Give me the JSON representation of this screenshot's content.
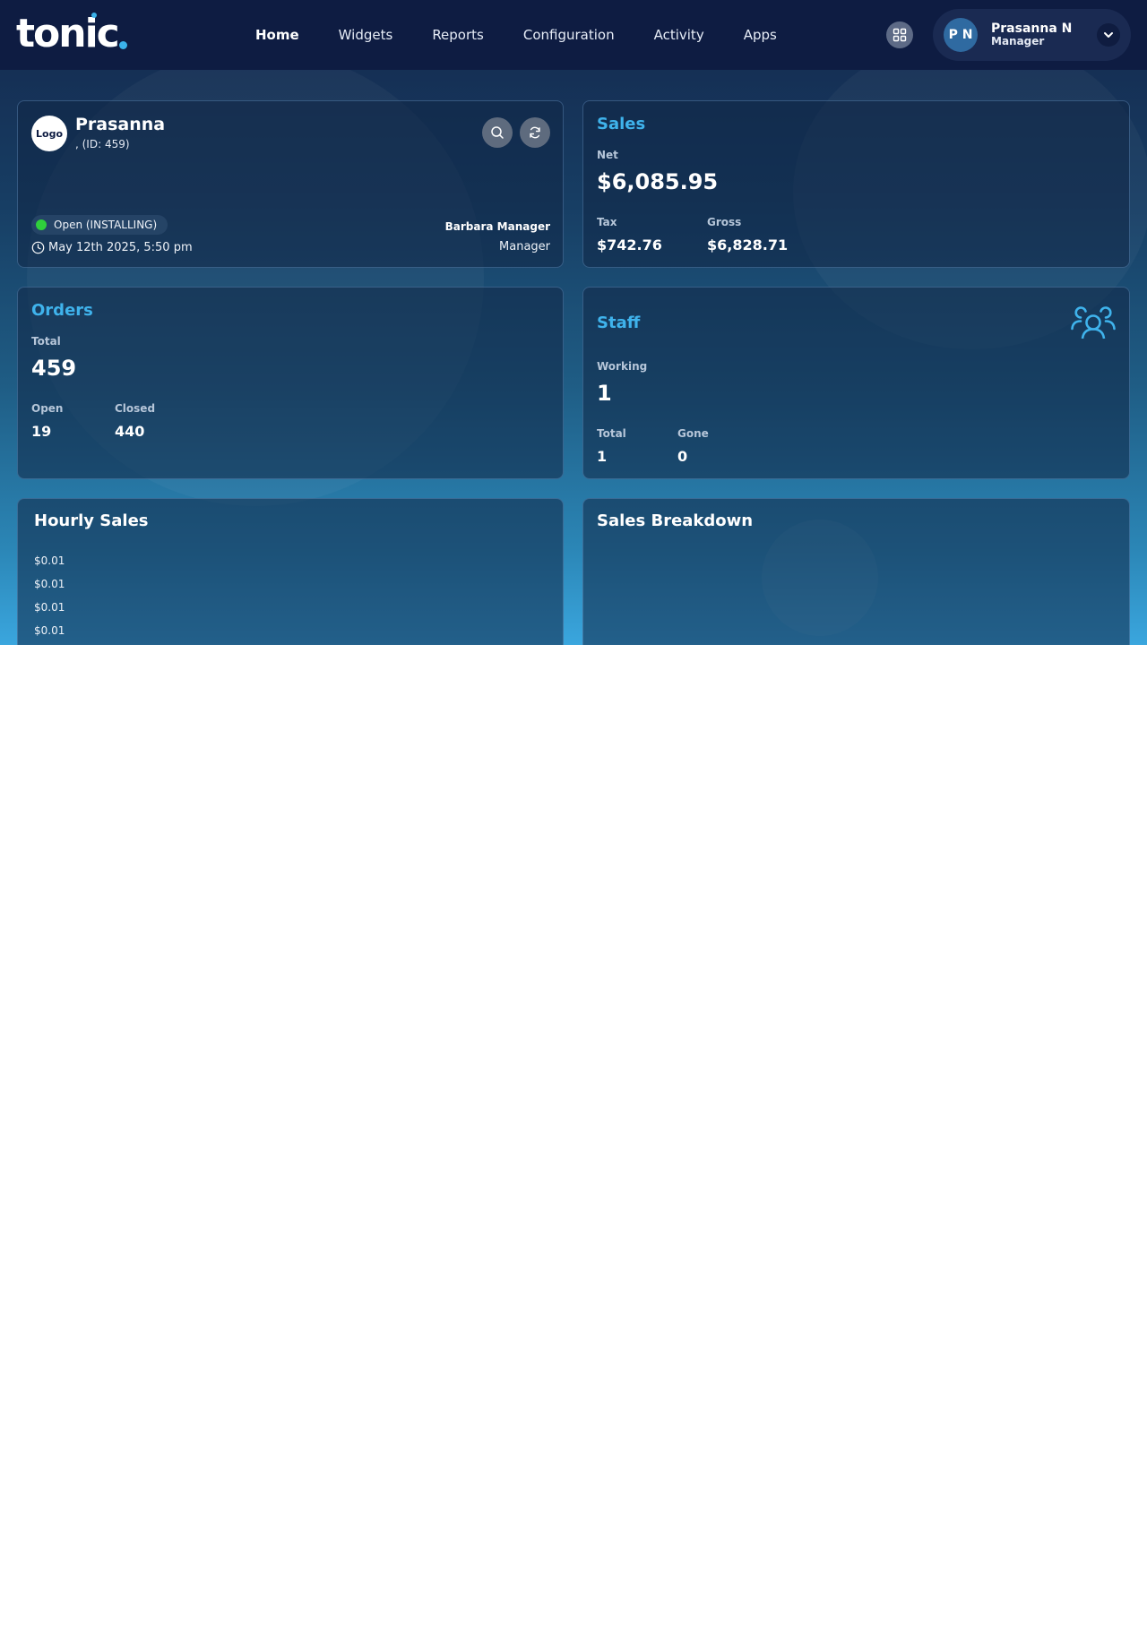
{
  "brand": {
    "logo_text": "tonic"
  },
  "nav": {
    "items": [
      {
        "label": "Home",
        "active": true
      },
      {
        "label": "Widgets"
      },
      {
        "label": "Reports"
      },
      {
        "label": "Configuration"
      },
      {
        "label": "Activity"
      },
      {
        "label": "Apps"
      }
    ]
  },
  "user": {
    "initials": "P N",
    "name": "Prasanna N",
    "role": "Manager"
  },
  "store": {
    "logo_label": "Logo",
    "name": "Prasanna",
    "id_line": ", (ID: 459)",
    "status": "Open (INSTALLING)",
    "status_color": "#2fcf3c",
    "datetime": "May 12th 2025, 5:50 pm",
    "manager_name": "Barbara Manager",
    "manager_role": "Manager"
  },
  "sales": {
    "title": "Sales",
    "net_label": "Net",
    "net_value": "$6,085.95",
    "tax_label": "Tax",
    "tax_value": "$742.76",
    "gross_label": "Gross",
    "gross_value": "$6,828.71"
  },
  "orders": {
    "title": "Orders",
    "total_label": "Total",
    "total_value": "459",
    "open_label": "Open",
    "open_value": "19",
    "closed_label": "Closed",
    "closed_value": "440"
  },
  "staff": {
    "title": "Staff",
    "working_label": "Working",
    "working_value": "1",
    "total_label": "Total",
    "total_value": "1",
    "gone_label": "Gone",
    "gone_value": "0"
  },
  "hourly_sales": {
    "title": "Hourly Sales",
    "y_ticks": [
      "$0.01",
      "$0.01",
      "$0.01",
      "$0.01"
    ]
  },
  "sales_breakdown": {
    "title": "Sales Breakdown"
  },
  "colors": {
    "accent": "#3fb3ec",
    "topbar": "#0e1c42"
  }
}
